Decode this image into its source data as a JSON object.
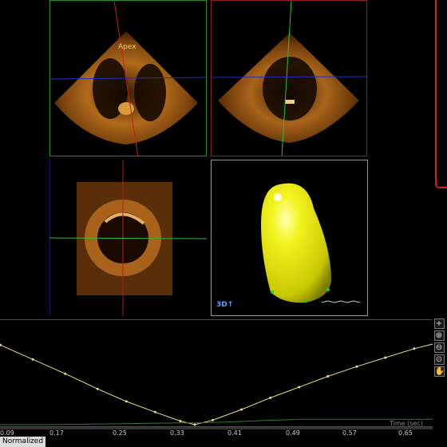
{
  "views": {
    "apex_label": "Apex",
    "render_mode_label": "3D↑"
  },
  "graph": {
    "x_ticks": [
      "0.09",
      "0.17",
      "0.25",
      "0.33",
      "0.41",
      "0.49",
      "0.57",
      "0.65"
    ],
    "time_label": "Time (sec)",
    "mode_label": "Normalized",
    "tool_icons": [
      "plus-icon",
      "zoom-in-icon",
      "zoom-out-icon",
      "zoom-reset-icon",
      "hand-icon"
    ],
    "colors": {
      "volume_curve": "#e8e080",
      "secondary_curve": "#2e7a2e",
      "axis": "#9a9a9a"
    }
  },
  "chart_data": {
    "type": "line",
    "xlabel": "Time (sec)",
    "xlim": [
      0.09,
      0.7
    ],
    "series": [
      {
        "x": [
          0.05,
          0.085,
          0.13,
          0.175,
          0.22,
          0.26,
          0.3,
          0.335,
          0.355,
          0.38,
          0.42,
          0.46,
          0.5,
          0.54,
          0.58,
          0.62,
          0.66,
          0.7
        ],
        "y": [
          1.0,
          0.89,
          0.73,
          0.57,
          0.4,
          0.26,
          0.14,
          0.04,
          0.0,
          0.05,
          0.17,
          0.3,
          0.42,
          0.54,
          0.65,
          0.75,
          0.85,
          0.93
        ]
      },
      {
        "x": [
          0.05,
          0.15,
          0.25,
          0.33,
          0.36,
          0.4,
          0.5,
          0.6,
          0.7
        ],
        "y": [
          0.0,
          0.0,
          0.01,
          0.02,
          0.02,
          0.03,
          0.06,
          0.06,
          0.06
        ]
      }
    ]
  }
}
